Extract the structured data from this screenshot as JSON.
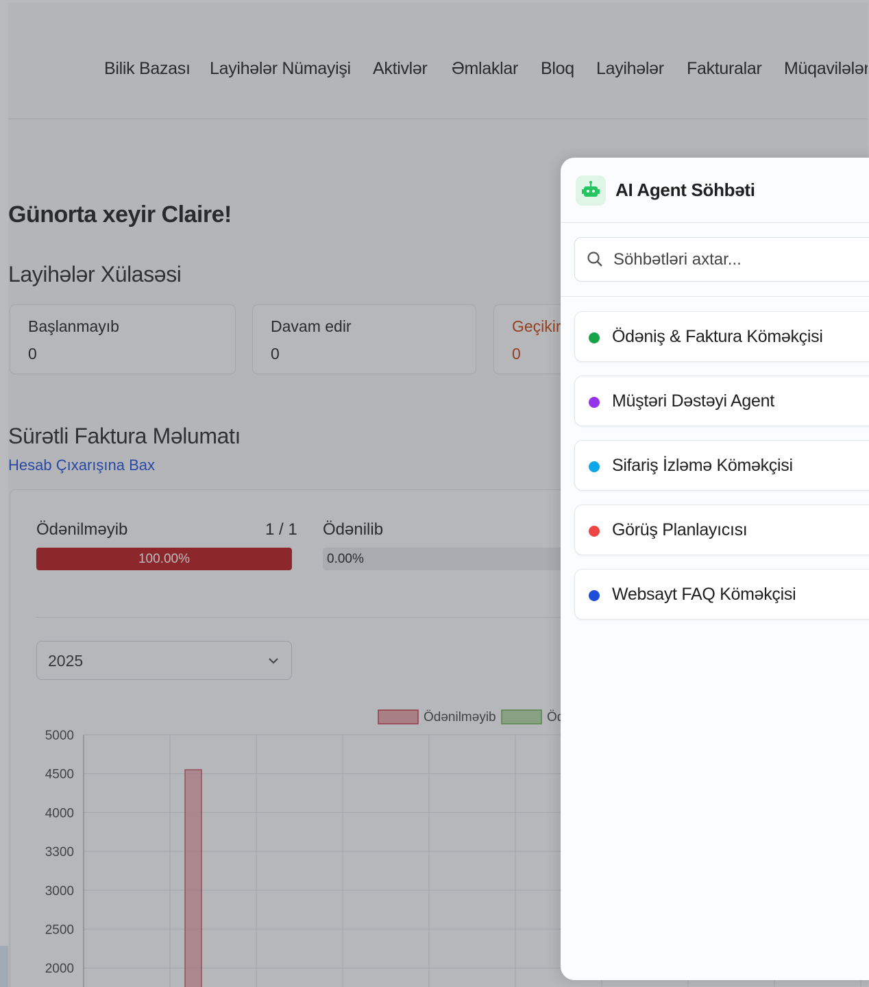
{
  "nav": {
    "items": [
      "Bilik Bazası",
      "Layihələr Nümayişi",
      "Aktivlər",
      "Əmlaklar",
      "Bloq",
      "Layihələr",
      "Fakturalar",
      "Müqavilələr"
    ]
  },
  "dashboard": {
    "greeting": "Günorta xeyir Claire!",
    "projects_summary_title": "Layihələr Xülasəsi",
    "stats": [
      {
        "label": "Başlanmayıb",
        "value": "0"
      },
      {
        "label": "Davam edir",
        "value": "0"
      },
      {
        "label": "Geçikir",
        "value": "0",
        "color": "#c2410c"
      }
    ],
    "invoice_title": "Sürətli Faktura Məlumatı",
    "statement_link": "Hesab Çıxarışına Bax",
    "unpaid_label": "Ödənilməyib",
    "unpaid_count": "1 / 1",
    "unpaid_percent_text": "100.00%",
    "unpaid_fraction": 1.0,
    "paid_label": "Ödənilib",
    "paid_percent_text": "0.00%",
    "paid_fraction": 0.0,
    "year_select": "2025"
  },
  "chart_data": {
    "type": "bar",
    "categories": [
      "",
      "",
      "",
      "",
      "",
      "",
      "",
      "",
      ""
    ],
    "series": [
      {
        "name": "Ödənilməyib",
        "color": "#e7a3aa",
        "values": [
          4550,
          null,
          null,
          null,
          null,
          null,
          null,
          null,
          null
        ]
      },
      {
        "name": "Ödənilib",
        "color": "#b6d7a8",
        "values": [
          null,
          null,
          null,
          null,
          null,
          null,
          null,
          null,
          null
        ]
      }
    ],
    "y_ticks": [
      "5000",
      "4500",
      "4000",
      "3300",
      "3000",
      "2500",
      "2000"
    ],
    "legend_position": "top",
    "grid": true
  },
  "chat": {
    "title": "AI Agent Söhbəti",
    "bot_icon": "robot-icon",
    "search_placeholder": "Söhbətləri axtar...",
    "agents": [
      {
        "name": "Ödəniş & Faktura Köməkçisi",
        "color": "#16a34a"
      },
      {
        "name": "Müştəri Dəstəyi Agent",
        "color": "#9333ea"
      },
      {
        "name": "Sifariş İzləmə Köməkçisi",
        "color": "#0ea5e9"
      },
      {
        "name": "Görüş Planlayıcısı",
        "color": "#ef4444"
      },
      {
        "name": "Websayt FAQ Köməkçisi",
        "color": "#1d4ed8"
      }
    ]
  }
}
